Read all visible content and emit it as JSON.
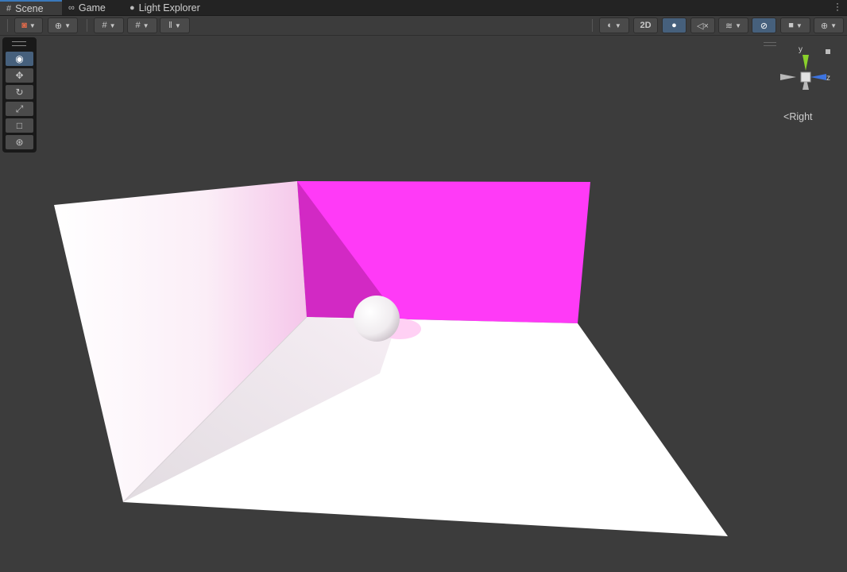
{
  "tabs": [
    {
      "label": "Scene",
      "icon": "grid-icon",
      "active": true
    },
    {
      "label": "Game",
      "icon": "gamepad-icon",
      "active": false
    },
    {
      "label": "Light Explorer",
      "icon": "bulb-icon",
      "active": false
    }
  ],
  "toolbar": {
    "mode_2d_label": "2D"
  },
  "gizmo": {
    "y_label": "y",
    "z_label": "z",
    "view_label": "Right",
    "view_arrow": "<"
  },
  "colors": {
    "accent": "#3a79bb",
    "selected": "#46607c",
    "magenta_wall": "#ff3af7",
    "axis_y": "#8ad12b",
    "axis_z": "#3d74e0"
  }
}
